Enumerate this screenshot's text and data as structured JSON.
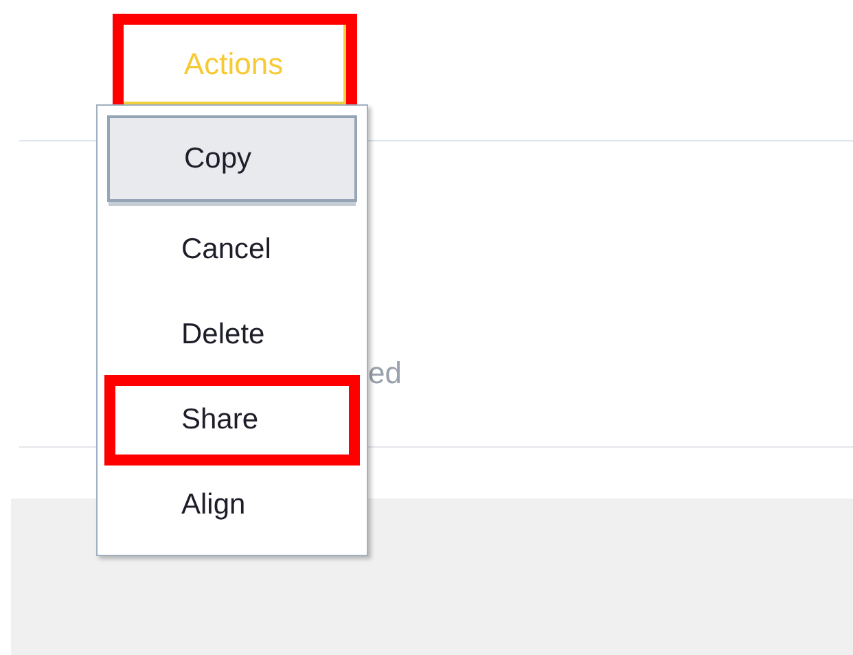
{
  "actions_button": {
    "label": "Actions",
    "highlighted": true
  },
  "background_text": "ed",
  "menu": {
    "items": [
      {
        "label": "Copy",
        "selected": true,
        "highlighted": false
      },
      {
        "label": "Cancel",
        "selected": false,
        "highlighted": false
      },
      {
        "label": "Delete",
        "selected": false,
        "highlighted": false
      },
      {
        "label": "Share",
        "selected": false,
        "highlighted": true
      },
      {
        "label": "Align",
        "selected": false,
        "highlighted": false
      }
    ]
  }
}
